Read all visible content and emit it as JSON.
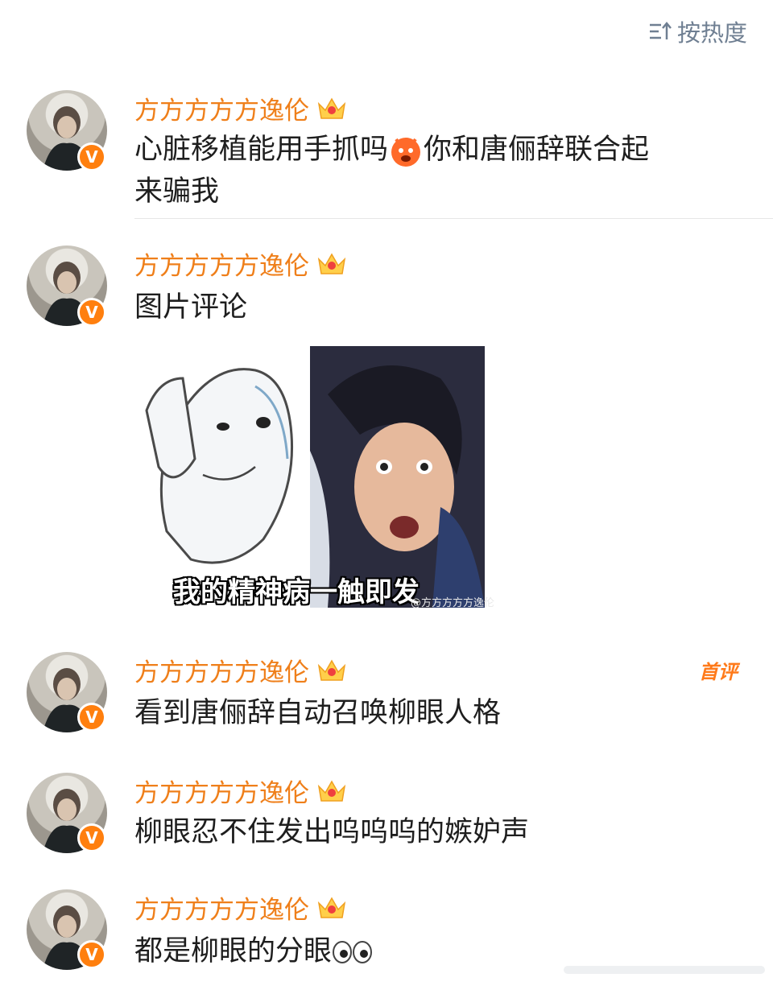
{
  "sort": {
    "label": "按热度",
    "icon": "sort-icon"
  },
  "comments": [
    {
      "user": "方方方方方逸伦",
      "text_line1": "心脏移植能用手抓吗",
      "text_line1b": "你和唐俪辞联合起",
      "text_line2": "来骗我",
      "emoji": "angry-face-emoji"
    },
    {
      "user": "方方方方方逸伦",
      "text": "图片评论",
      "image_caption": "我的精神病一触即发",
      "image_watermark": "@方方方方方逸伦"
    },
    {
      "user": "方方方方方逸伦",
      "text": "看到唐俪辞自动召唤柳眼人格",
      "tag": "首评"
    },
    {
      "user": "方方方方方逸伦",
      "text": "柳眼忍不住发出呜呜呜的嫉妒声"
    },
    {
      "user": "方方方方方逸伦",
      "text": "都是柳眼的分眼",
      "emoji": "eyes-emoji"
    }
  ],
  "badge": {
    "verified": "V",
    "name_color": "#ef7f1a",
    "verified_color": "#ff7f0e"
  }
}
